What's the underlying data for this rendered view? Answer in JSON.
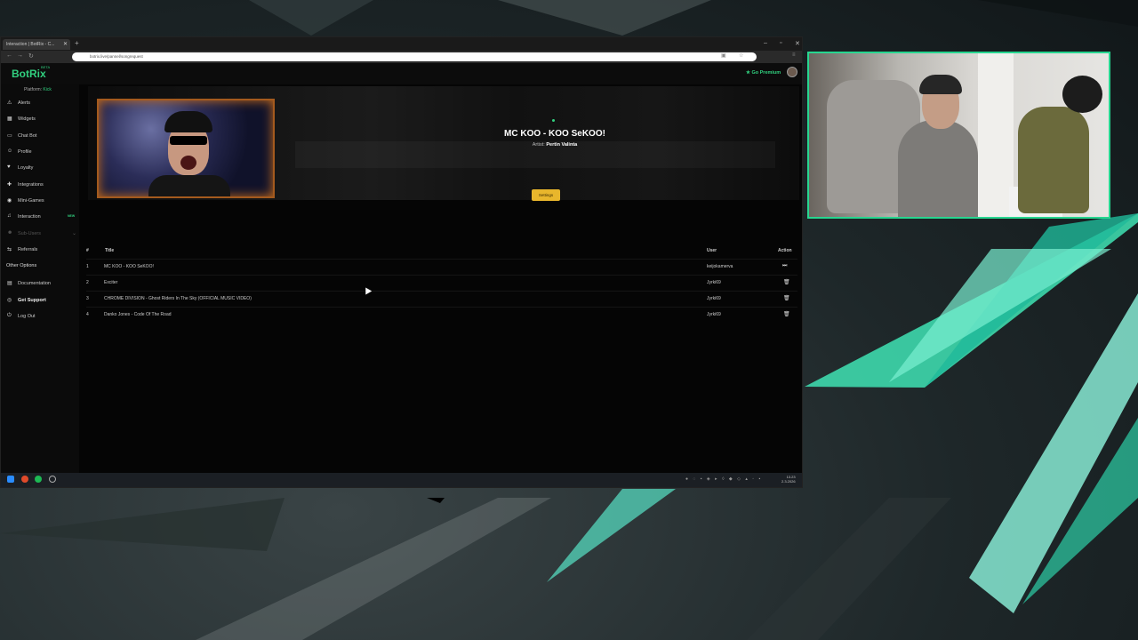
{
  "browser": {
    "tab_title": "Interaction | BotRix - C...",
    "url": "botrix.live/pannel/songrequest",
    "new_tab": "+"
  },
  "header": {
    "logo": "BotRix",
    "logo_badge": "BETA",
    "premium": "Go Premium"
  },
  "sidebar": {
    "platform_label": "Platform:",
    "platform_value": "Kick",
    "items": [
      {
        "label": "Alerts"
      },
      {
        "label": "Widgets"
      },
      {
        "label": "Chat Bot"
      },
      {
        "label": "Profile"
      },
      {
        "label": "Loyalty"
      },
      {
        "label": "Integrations"
      },
      {
        "label": "Mini-Games"
      },
      {
        "label": "Interaction",
        "badge": "NEW"
      },
      {
        "label": "Sub-Users"
      },
      {
        "label": "Referrals"
      }
    ],
    "other_heading": "Other Options",
    "other_items": [
      {
        "label": "Documentation"
      },
      {
        "label": "Get Support"
      },
      {
        "label": "Log Out"
      }
    ]
  },
  "now_playing": {
    "title": "MC KOO - KOO SeKOO!",
    "artist_label": "Artist:",
    "artist": "Pertin Valinta",
    "settings_button": "Settings"
  },
  "queue": {
    "columns": [
      "#",
      "Title",
      "User",
      "Action"
    ],
    "rows": [
      {
        "num": "1",
        "title": "MC KOO - KOO SeKOO!",
        "user": "keijokamerva",
        "action": "skip"
      },
      {
        "num": "2",
        "title": "Exciter",
        "user": "Jyrki69",
        "action": "delete"
      },
      {
        "num": "3",
        "title": "CHROME DIVISION - Ghost Riders In The Sky (OFFICIAL MUSIC VIDEO)",
        "user": "Jyrki69",
        "action": "delete"
      },
      {
        "num": "4",
        "title": "Danko Jones - Code Of The Road",
        "user": "Jyrki69",
        "action": "delete"
      }
    ]
  },
  "taskbar": {
    "time": "13.23",
    "date": "2.3.2026"
  },
  "colors": {
    "accent": "#31d07f",
    "settings_button": "#e8b62c",
    "webcam_border": "#27d690"
  }
}
